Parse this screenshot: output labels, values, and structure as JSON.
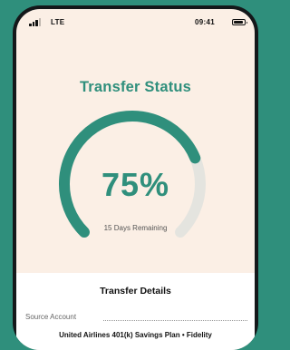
{
  "status_bar": {
    "network": "LTE",
    "time": "09:41"
  },
  "transfer": {
    "title": "Transfer Status",
    "progress": 0.75,
    "percent_label": "75%",
    "remaining_label": "15 Days Remaining"
  },
  "details": {
    "title": "Transfer Details",
    "source_label": "Source Account",
    "source_value": "United Airlines 401(k) Savings Plan • Fidelity"
  },
  "colors": {
    "accent": "#2f8f7c",
    "track": "#e4e4df",
    "screen_background": "#fbefe5"
  },
  "icons": {
    "signal": "cellular-signal-icon",
    "battery": "battery-icon"
  }
}
